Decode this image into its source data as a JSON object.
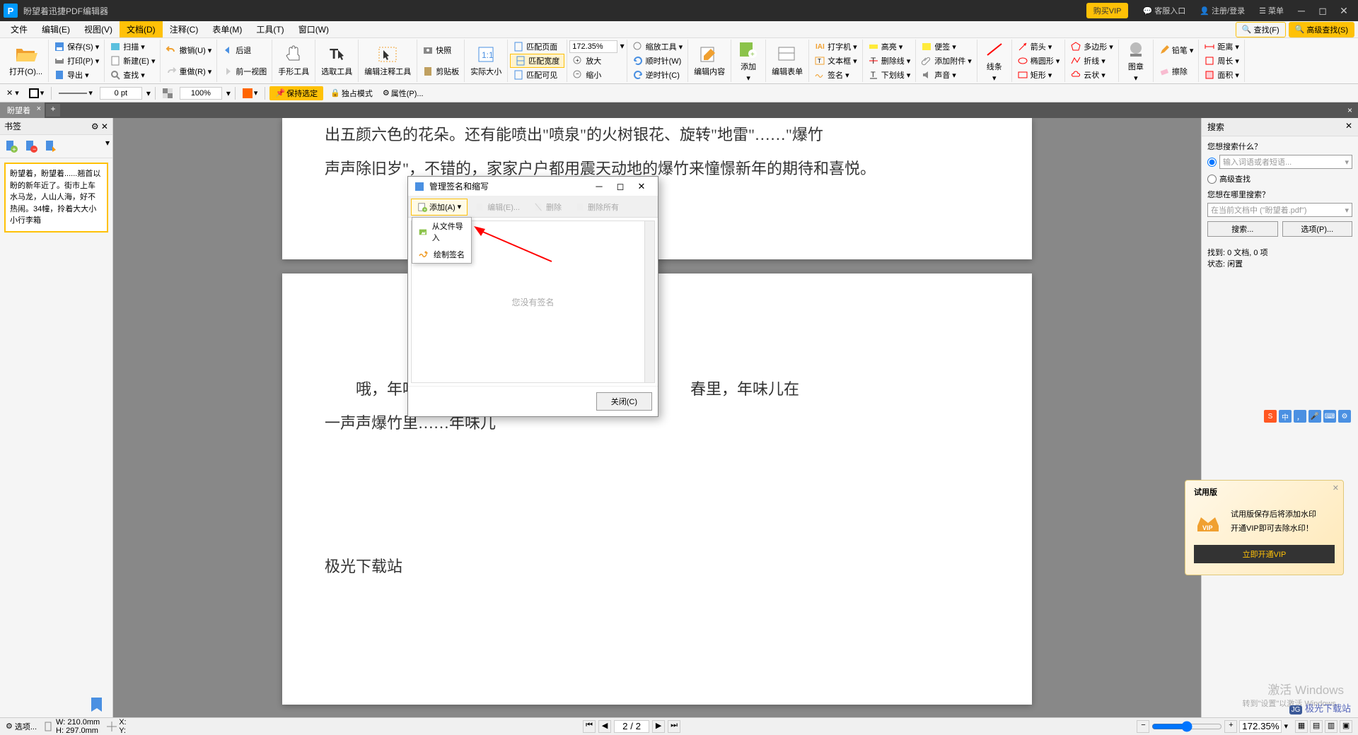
{
  "titlebar": {
    "app_name": "盼望着迅捷PDF编辑器",
    "vip": "购买VIP",
    "support": "客服入口",
    "login": "注册/登录",
    "menu": "菜单"
  },
  "menu": {
    "items": [
      "文件",
      "编辑(E)",
      "视图(V)",
      "文档(D)",
      "注释(C)",
      "表单(M)",
      "工具(T)",
      "窗口(W)"
    ],
    "active_index": 3,
    "search": "查找(F)",
    "adv_search": "高级查找(S)"
  },
  "ribbon": {
    "open": "打开(O)...",
    "save": "保存(S)",
    "print": "打印(P)",
    "export": "导出",
    "scan": "扫描",
    "new": "新建(E)",
    "find": "查找",
    "undo": "撤销(U)",
    "redo": "重做(R)",
    "back": "后退",
    "forward": "前一视图",
    "hand": "手形工具",
    "select": "选取工具",
    "annot": "编辑注释工具",
    "snap": "快照",
    "clip": "剪贴板",
    "realsize": "实际大小",
    "fitpage": "匹配页面",
    "fitwidth": "匹配宽度",
    "fitvis": "匹配可见",
    "zoom": "172.35%",
    "zoomin": "放大",
    "zoomout": "缩小",
    "zoomtool": "缩放工具",
    "cw": "顺时针(W)",
    "ccw": "逆时针(C)",
    "editcontent": "编辑内容",
    "add": "添加",
    "editform": "编辑表单",
    "typewriter": "打字机",
    "textbox": "文本框",
    "signature": "签名",
    "highlight": "高亮",
    "strikeout": "删除线",
    "underline": "下划线",
    "sticky": "便签",
    "attach": "添加附件",
    "sound": "声音",
    "line": "线条",
    "arrow": "箭头",
    "oval": "椭圆形",
    "rect": "矩形",
    "polygon": "多边形",
    "polyline": "折线",
    "cloud": "云状",
    "stamp": "图章",
    "pencil": "铅笔",
    "eraser": "擦除",
    "distance": "距离",
    "perimeter": "周长",
    "area": "面积"
  },
  "toolbar2": {
    "pt": "0 pt",
    "opacity": "100%",
    "keep": "保持选定",
    "exclusive": "独占模式",
    "props": "属性(P)..."
  },
  "tabs": {
    "name": "盼望着",
    "close_all_tooltip": "×"
  },
  "bookmarks": {
    "title": "书签",
    "item": "盼望着，盼望着......翘首以盼的新年近了。街市上车水马龙，人山人海，好不热闹。34幢，拎着大大小小行李箱"
  },
  "document": {
    "line1": "出五颜六色的花朵。还有能喷出\"喷泉\"的火树银花、旋转\"地雷\"……\"爆竹",
    "line2": "声声除旧岁\"，不错的，家家户户都用震天动地的爆竹来憧憬新年的期待和喜悦。",
    "line3": "哦，年味儿在爷爷的",
    "line3b": "春里，年味儿在",
    "line4": "一声声爆竹里……年味儿",
    "site": "极光下载站"
  },
  "dialog": {
    "title": "管理签名和缩写",
    "add": "添加(A)",
    "edit": "编辑(E)...",
    "delete": "删除",
    "delete_all": "删除所有",
    "from_file": "从文件导入",
    "draw": "绘制签名",
    "empty": "您没有签名",
    "close": "关闭(C)"
  },
  "search": {
    "title": "搜索",
    "what": "您想搜索什么？",
    "placeholder": "输入词语或者短语...",
    "adv": "高级查找",
    "where": "您想在哪里搜索？",
    "scope": "在当前文档中 (\"盼望着.pdf\")",
    "btn_search": "搜索...",
    "btn_options": "选项(P)...",
    "found": "找到: 0 文档, 0 项",
    "status": "状态: 闲置"
  },
  "trial": {
    "title": "试用版",
    "line1": "试用版保存后将添加水印",
    "line2": "开通VIP即可去除水印！",
    "btn": "立即开通VIP"
  },
  "statusbar": {
    "options": "选项...",
    "width": "W: 210.0mm",
    "height": "H: 297.0mm",
    "x": "X:",
    "y": "Y:",
    "page": "2 / 2",
    "zoom": "172.35%"
  },
  "watermark": {
    "line1": "激活 Windows",
    "line2": "转到\"设置\"以激活 Windows。",
    "logo": "极光下载站"
  },
  "ime": {
    "lang": "中"
  }
}
